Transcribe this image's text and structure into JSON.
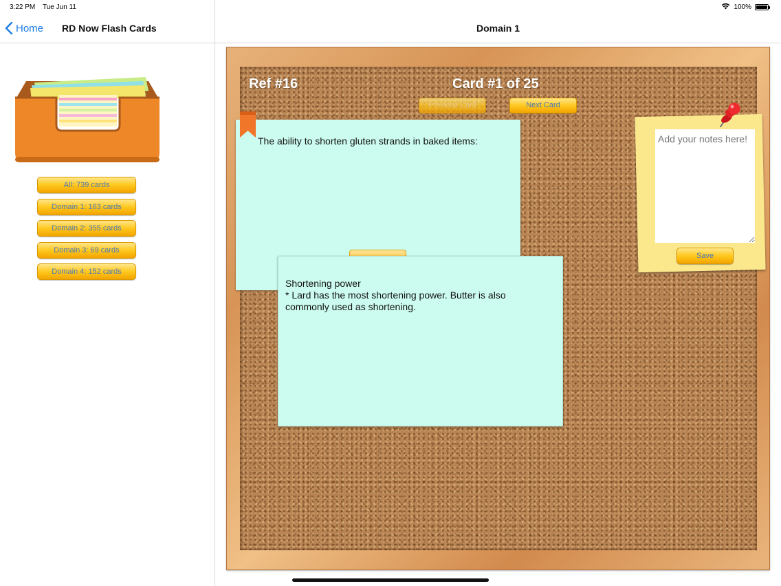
{
  "status_bar": {
    "time": "3:22 PM",
    "date": "Tue Jun 11",
    "battery": "100%",
    "battery_level": 1.0,
    "wifi_icon": "wifi-icon",
    "battery_icon": "battery-icon"
  },
  "sidebar": {
    "back_label": "Home",
    "title": "RD Now Flash Cards",
    "decks": [
      {
        "label": "All: 739 cards"
      },
      {
        "label": "Domain 1: 163 cards"
      },
      {
        "label": "Domain 2: 355 cards"
      },
      {
        "label": "Domain 3: 69 cards"
      },
      {
        "label": "Domain 4: 152 cards"
      }
    ]
  },
  "main": {
    "title": "Domain 1",
    "ref": "Ref #16",
    "card_count": "Card #1 of 25",
    "prev_label": "Previous Card",
    "next_label": "Next Card",
    "card_front": "The ability to shorten gluten strands in baked items:",
    "card_back_title": "Shortening power",
    "card_back_body": "* Lard has the most shortening power. Butter is also commonly used as shortening.",
    "notes_placeholder": "Add your notes here!",
    "save_label": "Save"
  },
  "colors": {
    "accent_blue": "#1a7ce6",
    "button_gold": "#ffc81f",
    "card_mint": "#ccfcef",
    "note_yellow": "#fbe88d",
    "cork": "#b98453",
    "frame_wood": "#e0a66c"
  }
}
